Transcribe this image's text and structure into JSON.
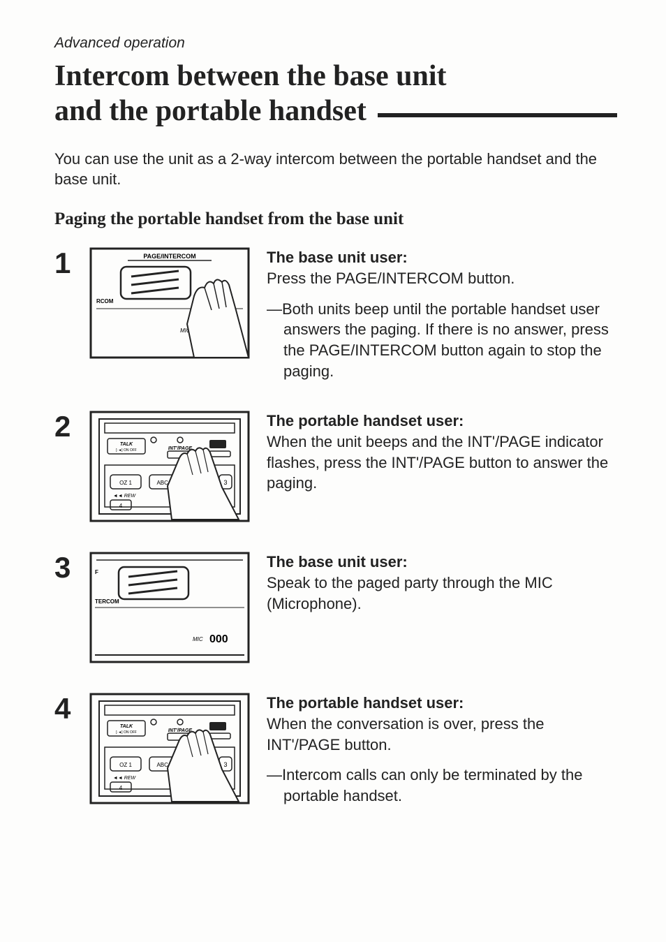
{
  "section": "Advanced operation",
  "title_line1": "Intercom between the base unit",
  "title_line2": "and the portable handset",
  "intro": "You can use the unit as a 2-way intercom between the portable handset and the base unit.",
  "subhead": "Paging the portable handset from the base unit",
  "steps": [
    {
      "num": "1",
      "heading": "The base unit user:",
      "body": "Press the PAGE/INTERCOM button.",
      "note": "—Both units beep until the portable handset user answers the paging. If there is no answer, press the PAGE/INTERCOM button again to stop the paging.",
      "fig_labels": {
        "top": "PAGE/INTERCOM",
        "left": "RCOM",
        "bottom": "MIC"
      }
    },
    {
      "num": "2",
      "heading": "The portable handset user:",
      "body": "When the unit beeps and the INT'/PAGE indicator flashes, press the INT'/PAGE button to answer the paging.",
      "note": "",
      "fig_labels": {
        "talk": "TALK",
        "int": "INT'/PAGE",
        "rew": "REW",
        "oz": "OZ 1",
        "abc": "ABC 2",
        "three": "3",
        "four": "4"
      }
    },
    {
      "num": "3",
      "heading": "The base unit user:",
      "body": "Speak to the paged party through the MIC (Microphone).",
      "note": "",
      "fig_labels": {
        "left": "TERCOM",
        "mic": "MIC",
        "holes": "000"
      }
    },
    {
      "num": "4",
      "heading": "The portable handset user:",
      "body": "When the conversation is over, press the INT'/PAGE button.",
      "note": "—Intercom calls can only be terminated by the portable handset.",
      "fig_labels": {
        "talk": "TALK",
        "int": "INT'/PAGE",
        "rew": "REW",
        "oz": "OZ 1",
        "abc": "ABC 2",
        "three": "3",
        "four": "4"
      }
    }
  ]
}
